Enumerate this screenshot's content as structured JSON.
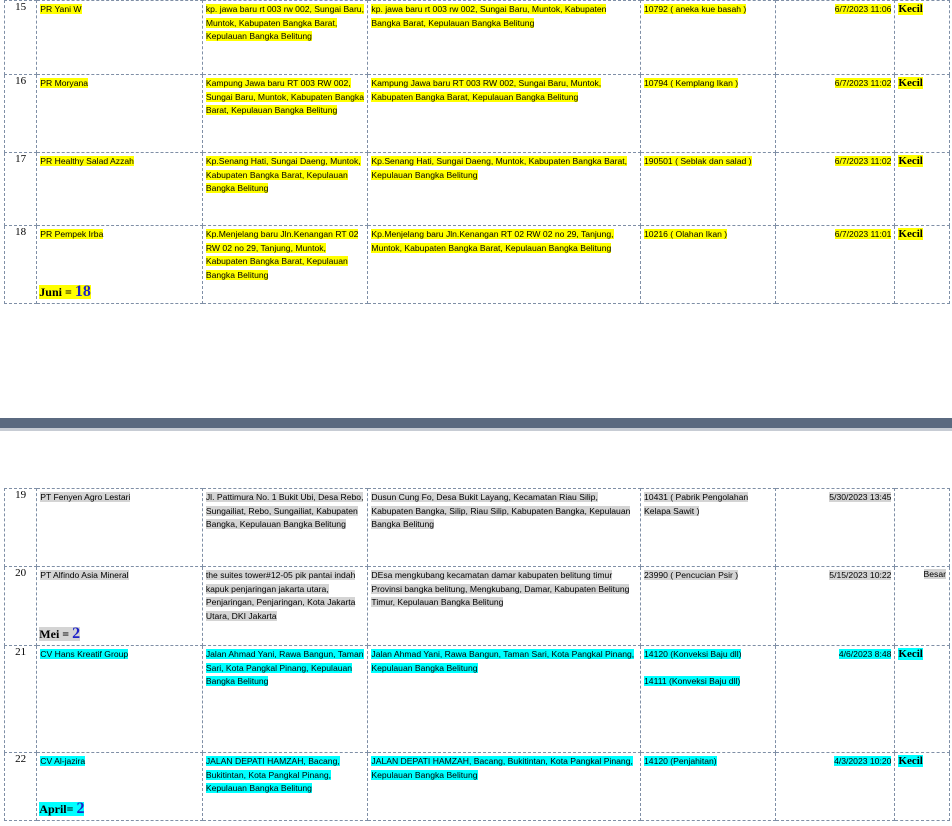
{
  "page1": {
    "rows": [
      {
        "no": "15",
        "name": "PR Yani W",
        "addr1": "kp. jawa baru rt 003 rw 002, Sungai Baru, Muntok, Kabupaten Bangka Barat, Kepulauan Bangka Belitung",
        "addr2": "kp. jawa baru rt 003 rw 002, Sungai Baru, Muntok, Kabupaten Bangka Barat, Kepulauan Bangka Belitung",
        "kbli": "10792 ( aneka kue basah )",
        "date": "6/7/2023 11:06",
        "size": "Kecil"
      },
      {
        "no": "16",
        "name": "PR Moryana",
        "addr1": "Kampung Jawa baru RT 003 RW 002, Sungai Baru, Muntok, Kabupaten Bangka Barat, Kepulauan Bangka Belitung",
        "addr2": "Kampung Jawa baru RT 003 RW 002, Sungai Baru, Muntok, Kabupaten Bangka Barat, Kepulauan Bangka Belitung",
        "kbli": "10794 ( Kemplang Ikan )",
        "date": "6/7/2023 11:02",
        "size": "Kecil"
      },
      {
        "no": "17",
        "name": "PR Healthy Salad Azzah",
        "addr1": "Kp.Senang Hati, Sungai Daeng, Muntok, Kabupaten Bangka Barat, Kepulauan Bangka Belitung",
        "addr2": "Kp.Senang Hati, Sungai Daeng, Muntok, Kabupaten Bangka Barat, Kepulauan Bangka Belitung",
        "kbli": "190501 ( Seblak dan salad )",
        "date": "6/7/2023 11:02",
        "size": "Kecil"
      },
      {
        "no": "18",
        "name": "PR Pempek Irba",
        "addr1": "Kp.Menjelang baru Jln.Kenangan RT 02 RW 02 no 29, Tanjung, Muntok, Kabupaten Bangka Barat, Kepulauan Bangka Belitung",
        "addr2": "Kp.Menjelang baru Jln.Kenangan RT 02 RW 02 no 29, Tanjung, Muntok, Kabupaten Bangka Barat, Kepulauan Bangka Belitung",
        "kbli": "10216 ( Olahan Ikan )",
        "date": "6/7/2023 11:01",
        "size": "Kecil"
      }
    ],
    "count_label": "Juni = ",
    "count_value": "18"
  },
  "page2": {
    "rows": [
      {
        "no": "19",
        "name": "PT Fenyen Agro Lestari",
        "addr1": "Jl. Pattimura No. 1 Bukit Ubi, Desa Rebo, Sungailiat, Rebo, Sungailiat, Kabupaten Bangka, Kepulauan Bangka Belitung",
        "addr2": "Dusun Cung Fo, Desa Bukit Layang, Kecamatan Riau Silip, Kabupaten Bangka, Silip, Riau Silip, Kabupaten Bangka, Kepulauan Bangka Belitung",
        "kbli": "10431 ( Pabrik Pengolahan Kelapa Sawit )",
        "date": "5/30/2023 13:45",
        "size": ""
      },
      {
        "no": "20",
        "name": "PT Alfindo Asia Mineral",
        "addr1": "the suites tower#12-05 pik pantai indah kapuk penjaringan jakarta utara, Penjaringan, Penjaringan, Kota Jakarta Utara, DKI Jakarta",
        "addr2": "DEsa mengkubang kecamatan damar kabupaten belitung timur Provinsi bangka belitung, Mengkubang, Damar, Kabupaten Belitung Timur, Kepulauan Bangka Belitung",
        "kbli": "23990 ( Pencucian Psir )",
        "date": "5/15/2023 10:22",
        "size": "Besar"
      },
      {
        "no": "21",
        "name": "CV Hans Kreatif Group",
        "addr1": "Jalan Ahmad Yani, Rawa Bangun, Taman Sari, Kota Pangkal Pinang, Kepulauan Bangka Belitung",
        "addr2": "Jalan Ahmad Yani, Rawa Bangun, Taman Sari, Kota Pangkal Pinang, Kepulauan Bangka Belitung",
        "kbli": "14120 (Konveksi Baju dll)",
        "kbli2": "14111 (Konveksi Baju dll)",
        "date": "4/6/2023 8:48",
        "size": "Kecil"
      },
      {
        "no": "22",
        "name": "CV Al-jazira",
        "addr1": "JALAN DEPATI HAMZAH, Bacang, Bukitintan, Kota Pangkal Pinang, Kepulauan Bangka Belitung",
        "addr2": "JALAN DEPATI HAMZAH, Bacang, Bukitintan, Kota Pangkal Pinang, Kepulauan Bangka Belitung",
        "kbli": "14120 (Penjahitan)",
        "date": "4/3/2023 10:20",
        "size": "Kecil"
      }
    ],
    "count_mei_label": "Mei = ",
    "count_mei_value": "2",
    "count_april_label": "April= ",
    "count_april_value": "2"
  },
  "colors": {
    "highlight_yellow": "#ffff00",
    "highlight_gray": "#d4d4d4",
    "highlight_cyan": "#00ffff",
    "count_number": "#1e22c8",
    "page_separator": "#5b6a80"
  }
}
